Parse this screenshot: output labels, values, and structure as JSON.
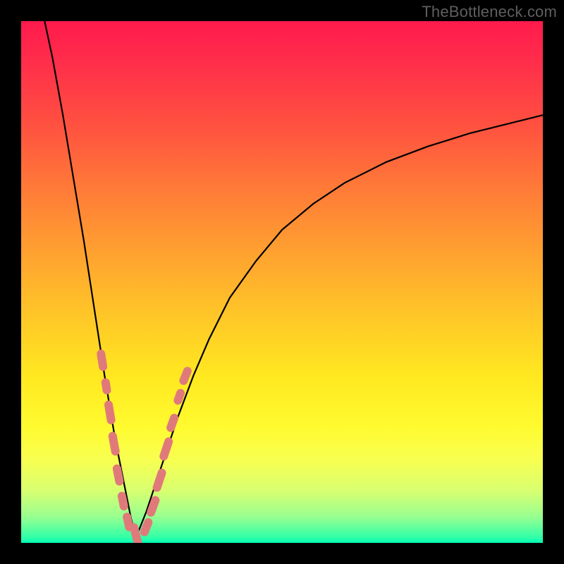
{
  "watermark": "TheBottleneck.com",
  "colors": {
    "frame": "#000000",
    "curve": "#000000",
    "marker": "#e07a7a",
    "gradient_top": "#ff1a4d",
    "gradient_bottom": "#00ffb8"
  },
  "chart_data": {
    "type": "line",
    "title": "",
    "xlabel": "",
    "ylabel": "",
    "xlim": [
      0,
      100
    ],
    "ylim": [
      0,
      100
    ],
    "note": "x and y read in percent of plot area; y=0 is bottom (green), y=100 is top (red). Two curve branches meeting near x≈22.",
    "series": [
      {
        "name": "left-branch",
        "x": [
          4.5,
          6,
          8,
          10,
          12,
          14,
          16,
          17,
          18,
          19,
          20,
          21,
          22
        ],
        "y": [
          100,
          93,
          82,
          70,
          58,
          45,
          32,
          26,
          20,
          15,
          10,
          5,
          1
        ]
      },
      {
        "name": "right-branch",
        "x": [
          22,
          24,
          26,
          28,
          30,
          33,
          36,
          40,
          45,
          50,
          56,
          62,
          70,
          78,
          86,
          94,
          100
        ],
        "y": [
          1,
          6,
          12,
          18,
          24,
          32,
          39,
          47,
          54,
          60,
          65,
          69,
          73,
          76,
          78.5,
          80.5,
          82
        ]
      }
    ],
    "markers": {
      "name": "highlighted-points",
      "note": "pink rounded segments along lower portion of both branches",
      "points": [
        {
          "x": 15.5,
          "y": 35,
          "len": 5
        },
        {
          "x": 16.3,
          "y": 30,
          "len": 3
        },
        {
          "x": 17.0,
          "y": 25,
          "len": 6
        },
        {
          "x": 17.8,
          "y": 19,
          "len": 6
        },
        {
          "x": 18.6,
          "y": 13,
          "len": 5
        },
        {
          "x": 19.5,
          "y": 8,
          "len": 4
        },
        {
          "x": 20.5,
          "y": 4,
          "len": 4
        },
        {
          "x": 22.0,
          "y": 1.5,
          "len": 6
        },
        {
          "x": 24.0,
          "y": 3,
          "len": 4
        },
        {
          "x": 25.3,
          "y": 7,
          "len": 5
        },
        {
          "x": 26.5,
          "y": 12,
          "len": 6
        },
        {
          "x": 27.8,
          "y": 18,
          "len": 6
        },
        {
          "x": 29.0,
          "y": 23,
          "len": 4
        },
        {
          "x": 30.3,
          "y": 28,
          "len": 3
        },
        {
          "x": 31.5,
          "y": 32,
          "len": 4
        }
      ]
    }
  }
}
